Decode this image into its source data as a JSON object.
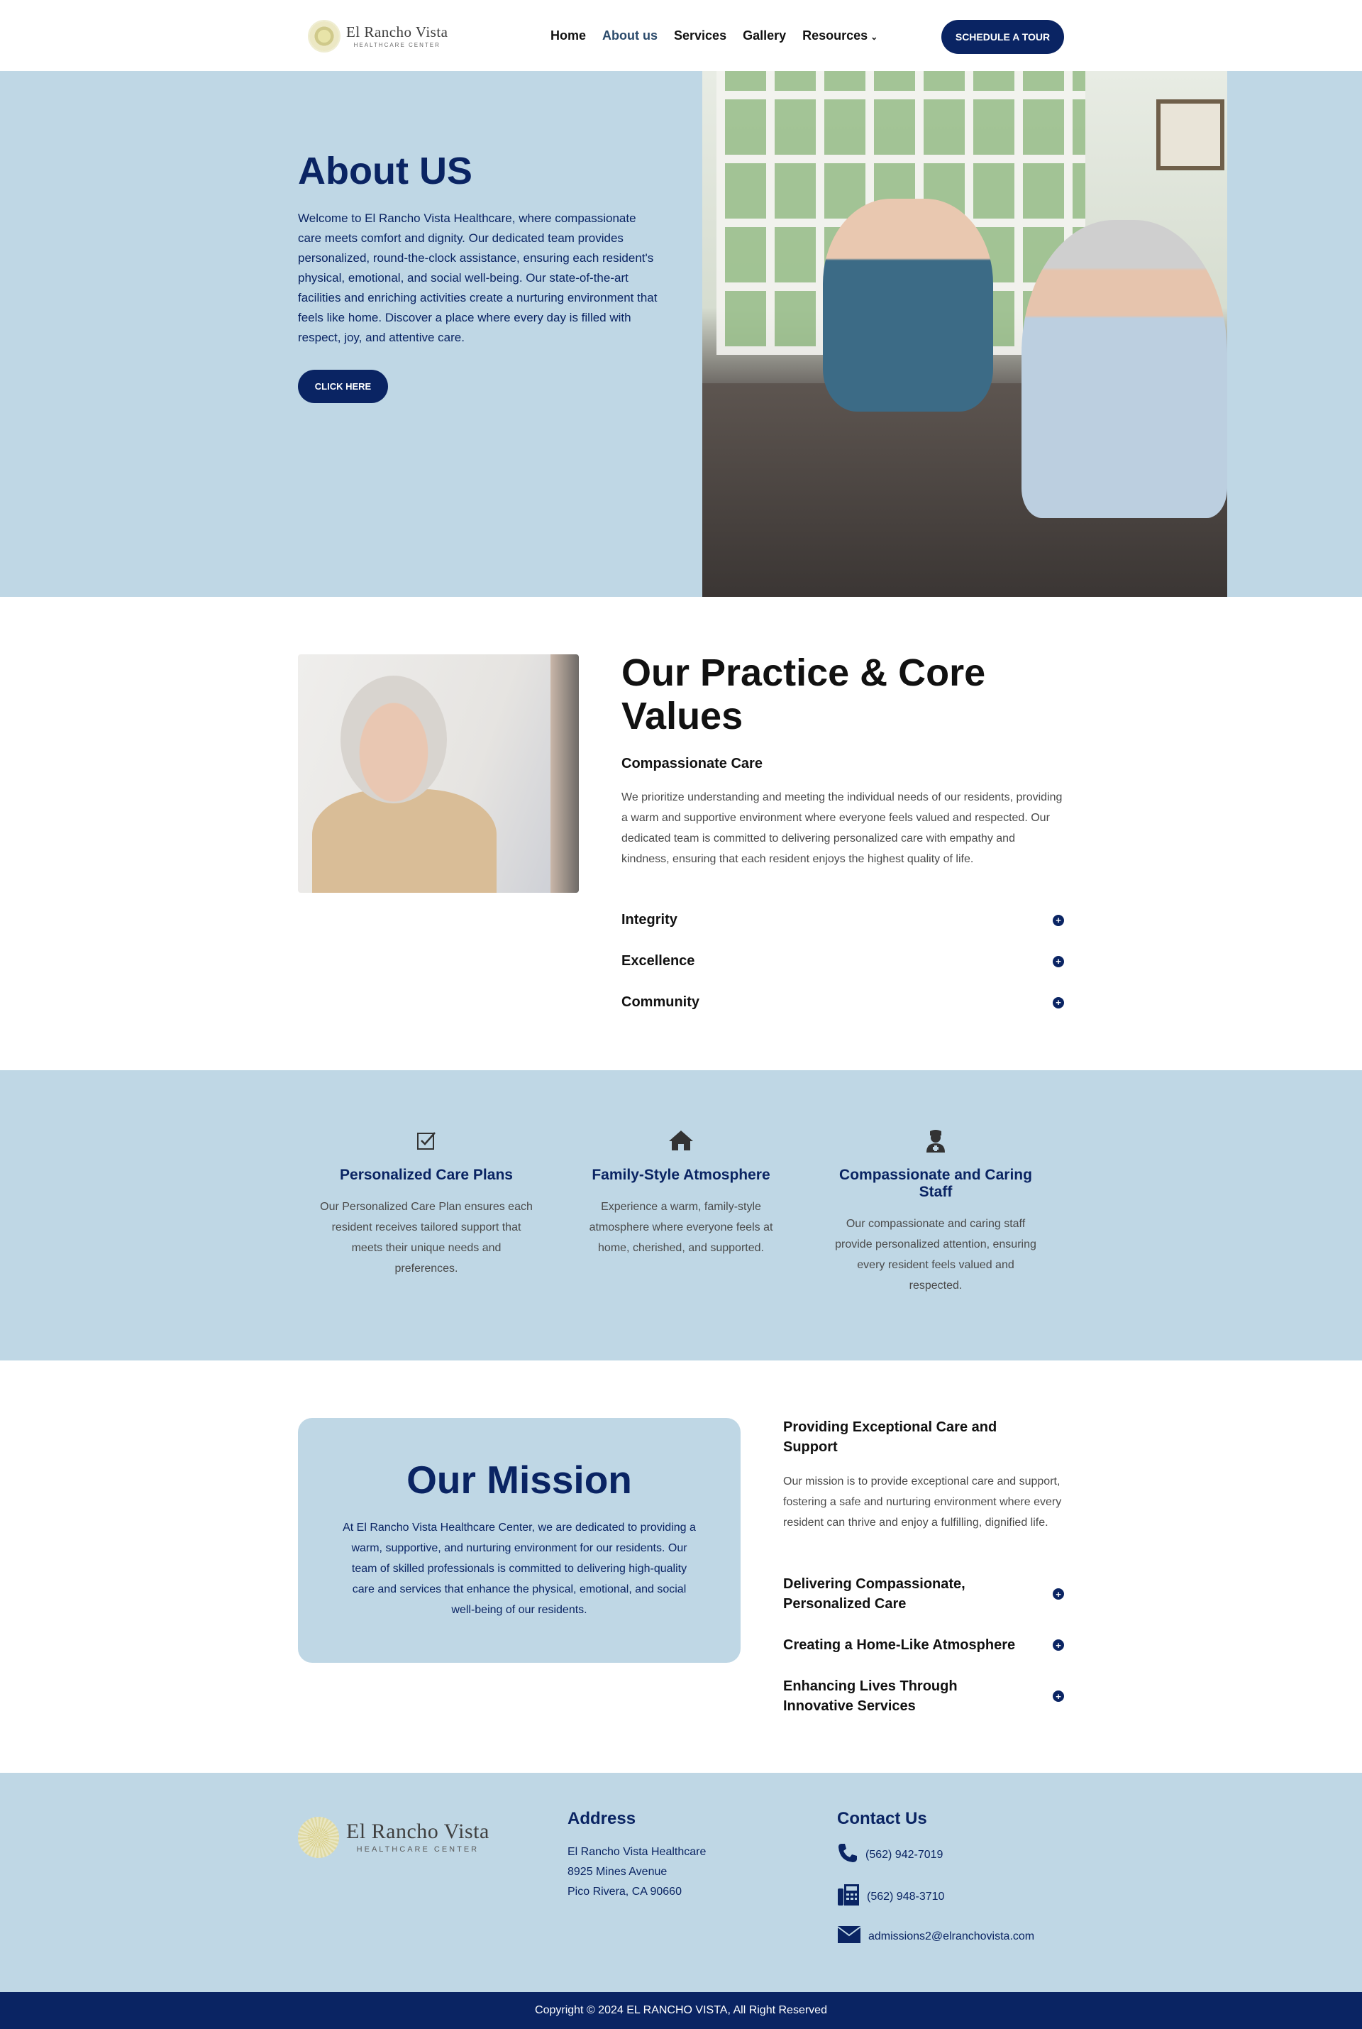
{
  "brand": {
    "name": "El Rancho Vista",
    "tagline": "HEALTHCARE CENTER"
  },
  "nav": {
    "items": [
      "Home",
      "About us",
      "Services",
      "Gallery",
      "Resources"
    ],
    "active": "About us",
    "cta": "SCHEDULE A TOUR"
  },
  "hero": {
    "title": "About US",
    "text": "Welcome to El Rancho Vista Healthcare, where compassionate care meets comfort and dignity. Our dedicated team provides personalized, round-the-clock assistance, ensuring each resident's physical, emotional, and social well-being. Our state-of-the-art facilities and enriching activities create a nurturing environment that feels like home. Discover a place where every day is filled with respect, joy, and attentive care.",
    "button": "CLICK HERE"
  },
  "practice": {
    "title": "Our Practice & Core Values",
    "open_item": {
      "title": "Compassionate Care",
      "text": "We prioritize understanding and meeting the individual needs of our residents, providing a warm and supportive environment where everyone feels valued and respected. Our dedicated team is committed to delivering personalized care with empathy and kindness, ensuring that each resident enjoys the highest quality of life."
    },
    "collapsed_items": [
      "Integrity",
      "Excellence",
      "Community"
    ]
  },
  "features": [
    {
      "icon": "checkbox-icon",
      "title": "Personalized Care Plans",
      "text": "Our Personalized Care Plan ensures each resident receives tailored support that meets their unique needs and preferences."
    },
    {
      "icon": "home-icon",
      "title": "Family-Style Atmosphere",
      "text": "Experience a warm, family-style atmosphere where everyone feels at home, cherished, and supported."
    },
    {
      "icon": "nurse-icon",
      "title": "Compassionate and Caring Staff",
      "text": "Our compassionate and caring staff provide personalized attention, ensuring every resident feels valued and respected."
    }
  ],
  "mission": {
    "title": "Our Mission",
    "text": "At El Rancho Vista Healthcare Center, we are dedicated to providing a warm, supportive, and nurturing environment for our residents. Our team of skilled professionals is committed to delivering high-quality care and services that enhance the physical, emotional, and social well-being of our residents.",
    "open_item": {
      "title": "Providing Exceptional Care and Support",
      "text": "Our mission is to provide exceptional care and support, fostering a safe and nurturing environment where every resident can thrive and enjoy a fulfilling, dignified life."
    },
    "collapsed_items": [
      "Delivering Compassionate, Personalized Care",
      "Creating a Home-Like Atmosphere",
      "Enhancing Lives Through Innovative Services"
    ]
  },
  "footer": {
    "address_title": "Address",
    "address_lines": [
      "El Rancho Vista Healthcare",
      "8925 Mines Avenue",
      "Pico Rivera, CA 90660"
    ],
    "contact_title": "Contact Us",
    "phone": "(562) 942-7019",
    "fax": "(562) 948-3710",
    "email": "admissions2@elranchovista.com",
    "copyright": "Copyright © 2024 EL RANCHO VISTA, All Right Reserved"
  },
  "colors": {
    "navy": "#0a2463",
    "light_blue": "#bfd7e5"
  }
}
